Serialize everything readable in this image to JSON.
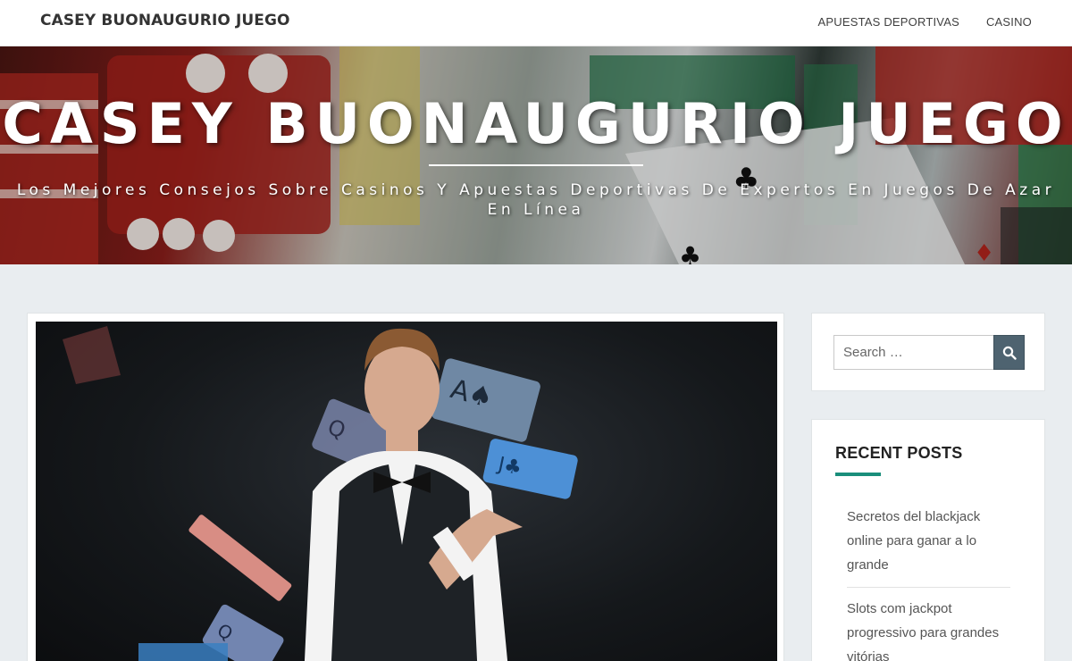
{
  "header": {
    "site_title": "CASEY BUONAUGURIO JUEGO",
    "nav": [
      {
        "label": "APUESTAS DEPORTIVAS"
      },
      {
        "label": "CASINO"
      }
    ]
  },
  "hero": {
    "title": "CASEY BUONAUGURIO JUEGO",
    "tagline": "Los Mejores Consejos Sobre Casinos Y Apuestas Deportivas De Expertos En Juegos De Azar En Línea"
  },
  "sidebar": {
    "search": {
      "placeholder": "Search …",
      "button_icon": "search-icon"
    },
    "recent_posts": {
      "title": "RECENT POSTS",
      "items": [
        {
          "label": "Secretos del blackjack online para ganar a lo grande"
        },
        {
          "label": "Slots com jackpot progressivo para grandes vitórias"
        }
      ]
    }
  },
  "colors": {
    "accent": "#1a8e7b",
    "search_button": "#4e6370",
    "page_background": "#e9edf0"
  }
}
